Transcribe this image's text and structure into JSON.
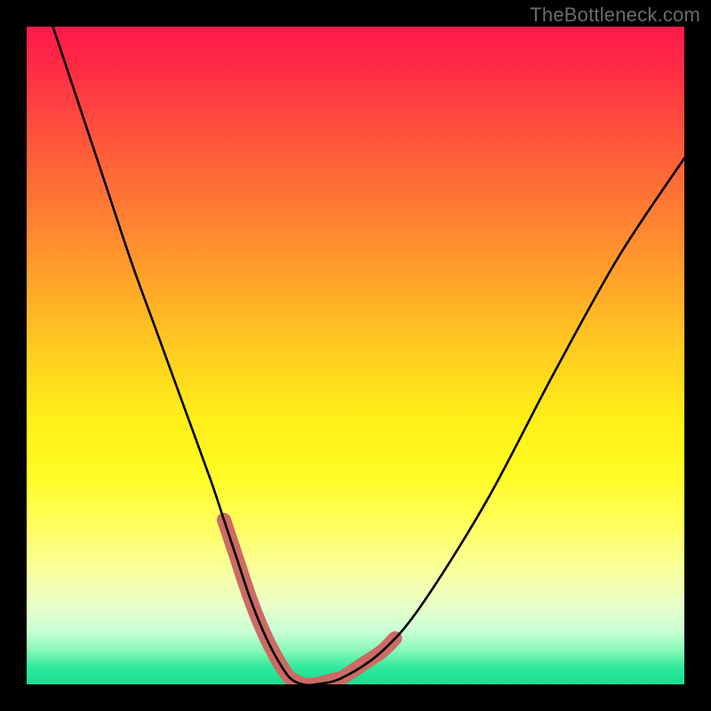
{
  "watermark": "TheBottleneck.com",
  "chart_data": {
    "type": "line",
    "title": "",
    "xlabel": "",
    "ylabel": "",
    "xlim": [
      0,
      100
    ],
    "ylim": [
      0,
      100
    ],
    "background_gradient": {
      "top": "#ff1a4b",
      "middle": "#fff018",
      "bottom": "#1add94"
    },
    "series": [
      {
        "name": "bottleneck-curve",
        "x": [
          4,
          8,
          12,
          16,
          20,
          24,
          28,
          30,
          32,
          34,
          36,
          38,
          40,
          42,
          44,
          48,
          54,
          60,
          70,
          80,
          90,
          100
        ],
        "y": [
          100,
          88,
          76,
          64,
          53,
          42,
          31,
          25,
          19,
          13,
          8,
          4,
          1,
          0,
          0,
          1,
          5,
          12,
          28,
          47,
          65,
          80
        ]
      }
    ],
    "highlight_segments": [
      {
        "name": "descending-tip",
        "x": [
          30,
          32,
          34,
          36,
          38,
          40,
          42
        ],
        "y": [
          25,
          19,
          13,
          8,
          4,
          1,
          0
        ]
      },
      {
        "name": "valley-floor",
        "x": [
          40,
          42,
          44,
          46,
          48
        ],
        "y": [
          1,
          0,
          0,
          0.5,
          1
        ]
      },
      {
        "name": "ascending-tip",
        "x": [
          48,
          51,
          54,
          56
        ],
        "y": [
          1,
          3,
          5,
          7
        ]
      }
    ],
    "colors": {
      "curve": "#000000",
      "highlight": "#cb6b64"
    }
  }
}
